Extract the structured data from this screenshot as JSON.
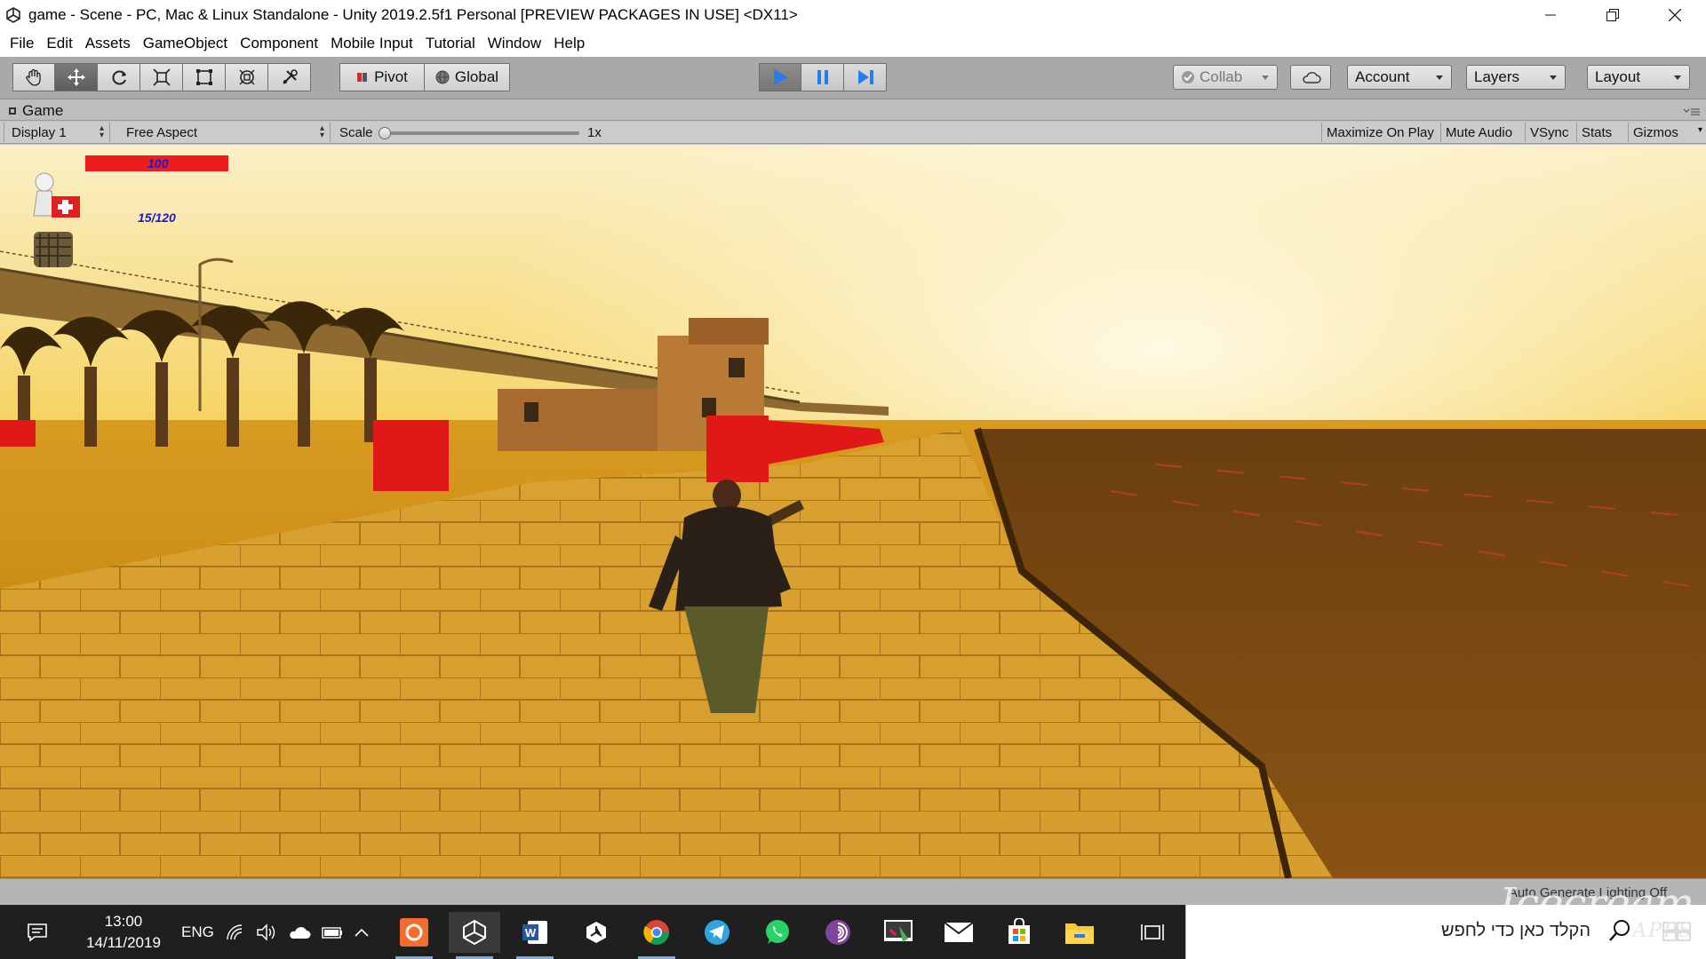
{
  "window": {
    "title": "game - Scene - PC, Mac & Linux Standalone - Unity 2019.2.5f1 Personal [PREVIEW PACKAGES IN USE] <DX11>"
  },
  "menu": [
    "File",
    "Edit",
    "Assets",
    "GameObject",
    "Component",
    "Mobile Input",
    "Tutorial",
    "Window",
    "Help"
  ],
  "toolbar": {
    "tools": [
      "hand-tool",
      "move-tool",
      "rotate-tool",
      "scale-tool",
      "rect-tool",
      "transform-tool",
      "custom-tool"
    ],
    "active_tool": "move-tool",
    "pivot_label": "Pivot",
    "global_label": "Global",
    "play_state": "playing",
    "collab_label": "Collab",
    "account_label": "Account",
    "layers_label": "Layers",
    "layout_label": "Layout"
  },
  "game_tab": {
    "label": "Game"
  },
  "game_bar": {
    "display": "Display 1",
    "aspect": "Free Aspect",
    "scale_label": "Scale",
    "scale_value": "1x",
    "scale_fraction": 0.0,
    "maximize_label": "Maximize On Play",
    "mute_label": "Mute Audio",
    "vsync_label": "VSync",
    "stats_label": "Stats",
    "gizmos_label": "Gizmos"
  },
  "hud": {
    "health_value": "100",
    "health_fraction": 1.0,
    "health_color": "#ee1c1c",
    "ammo_value": "15/120"
  },
  "status": {
    "text": "Auto Generate Lighting Off"
  },
  "taskbar": {
    "time": "13:00",
    "date": "14/11/2019",
    "language": "ENG",
    "search_placeholder": "הקלד כאן כדי לחפש",
    "apps": [
      "origin-icon",
      "unity-icon",
      "word-icon",
      "unity-hub-icon",
      "chrome-icon",
      "telegram-icon",
      "whatsapp-icon",
      "tor-icon",
      "paint-icon",
      "mail-icon",
      "store-icon",
      "file-explorer-icon",
      "task-view-icon"
    ]
  },
  "watermark": {
    "text": "Icecream",
    "subtext": "APPS"
  }
}
